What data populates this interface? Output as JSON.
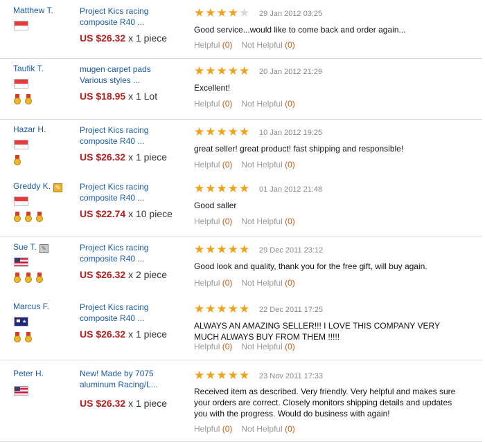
{
  "colors": {
    "link": "#1a5aa6",
    "price": "#b22020",
    "stars": "#f0a21b",
    "count": "#c75c18"
  },
  "labels": {
    "helpful": "Helpful",
    "not_helpful": "Not Helpful"
  },
  "reviews": [
    {
      "buyer": "Matthew T.",
      "product": "Project Kics racing composite R40 ...",
      "price": "US $26.32",
      "quantity": "x 1 piece",
      "stars": 4,
      "date": "29 Jan 2012 03:25",
      "comment": "Good service...would like to come back and order again...",
      "helpful": "(0)",
      "not_helpful": "(0)",
      "flag": "singapore",
      "medals": 0
    },
    {
      "buyer": "Taufik T.",
      "product": "mugen carpet pads Various styles ...",
      "price": "US $18.95",
      "quantity": "x 1 Lot",
      "stars": 5,
      "date": "20 Jan 2012 21:29",
      "comment": "Excellent!",
      "helpful": "(0)",
      "not_helpful": "(0)",
      "flag": "singapore",
      "medals": 2
    },
    {
      "buyer": "Hazar H.",
      "product": "Project Kics racing composite R40 ...",
      "price": "US $26.32",
      "quantity": "x 1 piece",
      "stars": 5,
      "date": "10 Jan 2012 19:25",
      "comment": "great seller! great product! fast shipping and responsible!",
      "helpful": "(0)",
      "not_helpful": "(0)",
      "flag": "singapore",
      "medals": 1
    },
    {
      "buyer": "Greddy K.",
      "product": "Project Kics racing composite R40 ...",
      "price": "US $22.74",
      "quantity": "x 10 piece",
      "stars": 5,
      "date": "01 Jan 2012 21:48",
      "comment": "Good saller",
      "helpful": "(0)",
      "not_helpful": "(0)",
      "flag": "singapore",
      "medals": 3,
      "mark": "gold"
    },
    {
      "buyer": "Sue T.",
      "product": "Project Kics racing composite R40 ...",
      "price": "US $26.32",
      "quantity": "x 2 piece",
      "stars": 5,
      "date": "29 Dec 2011 23:12",
      "comment": "Good look and quality, thank you for the free gift, will buy again.",
      "helpful": "(0)",
      "not_helpful": "(0)",
      "flag": "usa",
      "medals": 3,
      "mark": "gray"
    },
    {
      "buyer": "Marcus F.",
      "product": "Project Kics racing composite R40 ...",
      "price": "US $26.32",
      "quantity": "x 1 piece",
      "stars": 5,
      "date": "22 Dec 2011 17:25",
      "comment": "ALWAYS AN AMAZING SELLER!!! I LOVE THIS COMPANY VERY MUCH ALWAYS BUY FROM THEM !!!!!",
      "helpful": "(0)",
      "not_helpful": "(0)",
      "flag": "australia",
      "medals": 2
    },
    {
      "buyer": "Peter H.",
      "product": "New! Made by 7075 aluminum Racing/L...",
      "price": "US $26.32",
      "quantity": "x 1 piece",
      "stars": 5,
      "date": "23 Nov 2011 17:33",
      "comment": "Received item as described. Very friendly. Very helpful and makes sure your orders are correct. Closely monitors shipping details and updates you with the progress. Would do business with again!",
      "helpful": "(0)",
      "not_helpful": "(0)",
      "flag": "usa",
      "medals": 0
    }
  ]
}
